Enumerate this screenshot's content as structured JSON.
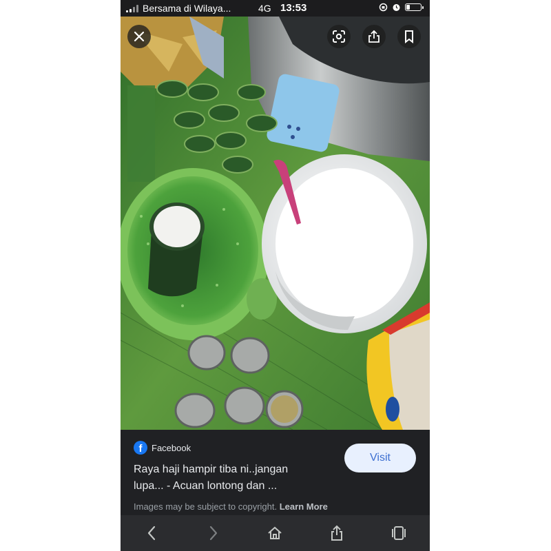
{
  "status_bar": {
    "carrier": "Bersama di Wilaya...",
    "network": "4G",
    "time": "13:53",
    "battery_level": 0.25
  },
  "viewer": {
    "close_icon": "close-icon",
    "lens_icon": "lens-icon",
    "share_icon": "share-icon",
    "bookmark_icon": "bookmark-icon"
  },
  "result": {
    "source": "Facebook",
    "source_icon": "facebook-icon",
    "title": "Raya haji hampir tiba ni..jangan lupa... - Acuan lontong dan ...",
    "visit_label": "Visit",
    "copyright_text": "Images may be subject to copyright.",
    "learn_more": "Learn More"
  },
  "toolbar": {
    "icons": [
      "back-icon",
      "forward-icon",
      "home-icon",
      "share-icon",
      "tabs-icon"
    ]
  },
  "colors": {
    "panel_bg": "#202124",
    "visit_bg": "#e8f0fe",
    "visit_text": "#3c6fd1",
    "facebook_blue": "#1877f2"
  }
}
